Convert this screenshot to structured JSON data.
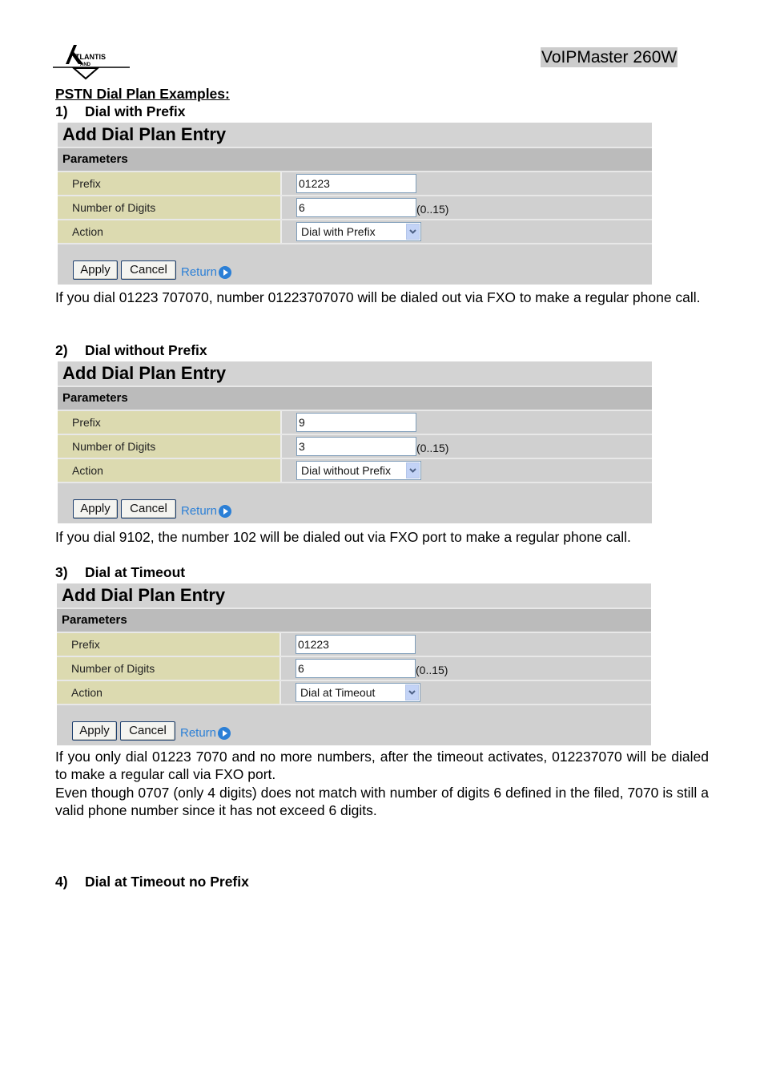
{
  "header": {
    "logo_text": "ATLANTIS AND",
    "product_name": "VoIPMaster 260W"
  },
  "page_heading": "PSTN Dial Plan Examples:",
  "panel_common": {
    "title": "Add Dial Plan Entry",
    "section": "Parameters",
    "labels": {
      "prefix": "Prefix",
      "digits": "Number of Digits",
      "action": "Action"
    },
    "digits_hint": "(0..15)",
    "apply_label": "Apply",
    "cancel_label": "Cancel",
    "return_label": "Return"
  },
  "examples": [
    {
      "number": "1)",
      "title": "Dial with Prefix",
      "prefix": "01223",
      "digits": "6",
      "action": "Dial with Prefix",
      "description": "If you dial 01223 707070, number 01223707070 will be dialed out via FXO to make a regular phone call."
    },
    {
      "number": "2)",
      "title": "Dial without Prefix",
      "prefix": "9",
      "digits": "3",
      "action": "Dial without Prefix",
      "description": "If you dial 9102, the number 102 will be dialed out via FXO port to make a regular phone call."
    },
    {
      "number": "3)",
      "title": "Dial at Timeout",
      "prefix": "01223",
      "digits": "6",
      "action": "Dial at Timeout",
      "description": "If you only dial 01223 7070 and no more numbers, after the timeout activates, 012237070 will be dialed to make a regular call via FXO port.",
      "description2": "Even though 0707 (only 4 digits) does not match with number of digits 6 defined in the filed, 7070 is still a valid phone number since it has not exceed 6 digits."
    },
    {
      "number": "4)",
      "title": "Dial at Timeout no Prefix"
    }
  ],
  "colors": {
    "panel_bg": "#d0d0d0",
    "params_bg": "#bbbbbb",
    "label_bg": "#dcdab0",
    "link": "#2b7fd6",
    "product_bg": "#cccccc"
  }
}
